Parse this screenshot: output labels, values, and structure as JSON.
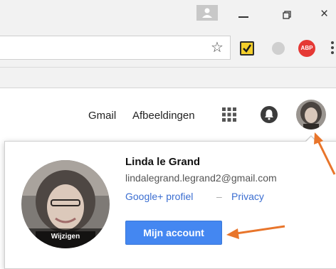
{
  "window": {
    "minimize_icon": "minimize-icon",
    "restore_icon": "restore-icon",
    "close_glyph": "×"
  },
  "toolbar": {
    "star_glyph": "☆",
    "extensions": [
      "checkmark-extension-icon",
      "grey-extension-icon",
      "adblock-plus-icon"
    ],
    "abp_label": "ABP"
  },
  "header": {
    "links": {
      "gmail": "Gmail",
      "images": "Afbeeldingen"
    },
    "icons": [
      "apps-grid-icon",
      "notifications-bell-icon",
      "account-avatar"
    ]
  },
  "account_popup": {
    "name": "Linda le Grand",
    "email": "lindalegrand.legrand2@gmail.com",
    "links": {
      "profile": "Google+ profiel",
      "separator": "–",
      "privacy": "Privacy"
    },
    "avatar_change_label": "Wijzigen",
    "account_button": "Mijn account"
  },
  "colors": {
    "accent_button": "#4487f1",
    "link": "#3b6ed1",
    "annotation_arrow": "#e8752b"
  }
}
